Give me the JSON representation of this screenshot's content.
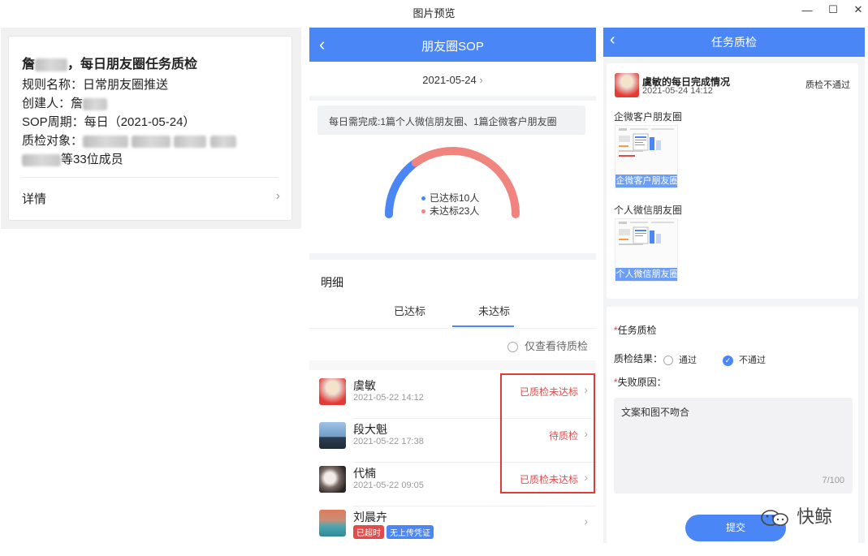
{
  "window": {
    "title": "图片预览",
    "min_glyph": "—",
    "max_glyph": "☐",
    "close_glyph": "✕"
  },
  "panel1": {
    "name_suffix": "，每日朋友圈任务质检",
    "name_prefix": "詹",
    "rule_label": "规则名称：日常朋友圈推送",
    "creator_label": "创建人：詹",
    "sop_label": "SOP周期：每日（2021-05-24）",
    "target_label": "质检对象：",
    "target_tail": "等33位成员",
    "detail": "详情",
    "chevron": "›"
  },
  "panel2": {
    "nav_title": "朋友圈SOP",
    "back": "‹",
    "date": "2021-05-24",
    "date_chevron": "›",
    "info": "每日需完成:1篇个人微信朋友圈、1篇企微客户朋友圈",
    "legend": [
      {
        "text": "已达标10人",
        "color": "#4a86f5"
      },
      {
        "text": "未达标23人",
        "color": "#f0857f"
      }
    ],
    "chart_data": {
      "type": "pie",
      "categories": [
        "已达标",
        "未达标"
      ],
      "values": [
        10,
        23
      ]
    },
    "detail_title": "明细",
    "tabs": [
      "已达标",
      "未达标"
    ],
    "filter": "仅查看待质检",
    "rows": [
      {
        "name": "虞敏",
        "date": "2021-05-22 14:12",
        "status": "已质检未达标"
      },
      {
        "name": "段大魁",
        "date": "2021-05-22 17:38",
        "status": "待质检"
      },
      {
        "name": "代楠",
        "date": "2021-05-22 09:05",
        "status": "已质检未达标"
      },
      {
        "name": "刘晨卉",
        "tags": [
          "已超时",
          "无上传凭证"
        ]
      }
    ],
    "row_chevron": "›"
  },
  "panel3": {
    "nav_title": "任务质检",
    "back": "‹",
    "user_title": "虞敏的每日完成情况",
    "user_date": "2021-05-24 14:12",
    "user_status": "质检不通过",
    "section1": "企微客户朋友圈",
    "section1_tag": "企微客户朋友圈",
    "section2": "个人微信朋友圈",
    "section2_tag": "个人微信朋友圈",
    "qc_title": "任务质检",
    "result_label": "质检结果：",
    "opt_pass": "通过",
    "opt_fail": "不通过",
    "reason_label": "失败原因：",
    "reason_text": "文案和图不吻合",
    "counter": "7/100",
    "submit": "提交",
    "required_mark": "*"
  },
  "watermark": {
    "text": "快鲸"
  }
}
